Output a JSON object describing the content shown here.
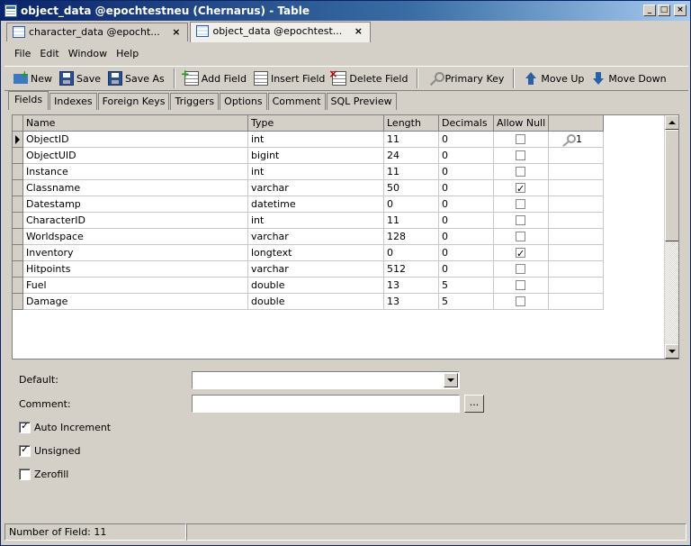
{
  "window": {
    "title": "object_data @epochtestneu (Chernarus) - Table",
    "minimize": "_",
    "maximize": "□",
    "close": "×"
  },
  "doc_tabs": [
    {
      "label": "character_data @epocht...",
      "close": "×",
      "active": false
    },
    {
      "label": "object_data @epochtest...",
      "close": "×",
      "active": true
    }
  ],
  "menu": [
    "File",
    "Edit",
    "Window",
    "Help"
  ],
  "toolbar": {
    "new_label": "New",
    "save_label": "Save",
    "save_as_label": "Save As",
    "add_field_label": "Add Field",
    "insert_field_label": "Insert Field",
    "delete_field_label": "Delete Field",
    "primary_key_label": "Primary Key",
    "move_up_label": "Move Up",
    "move_down_label": "Move Down"
  },
  "sub_tabs": [
    "Fields",
    "Indexes",
    "Foreign Keys",
    "Triggers",
    "Options",
    "Comment",
    "SQL Preview"
  ],
  "grid": {
    "columns": [
      "Name",
      "Type",
      "Length",
      "Decimals",
      "Allow Null",
      ""
    ],
    "rows": [
      {
        "name": "ObjectID",
        "type": "int",
        "length": "11",
        "decimals": "0",
        "allow_null": false,
        "key": "1"
      },
      {
        "name": "ObjectUID",
        "type": "bigint",
        "length": "24",
        "decimals": "0",
        "allow_null": false,
        "key": ""
      },
      {
        "name": "Instance",
        "type": "int",
        "length": "11",
        "decimals": "0",
        "allow_null": false,
        "key": ""
      },
      {
        "name": "Classname",
        "type": "varchar",
        "length": "50",
        "decimals": "0",
        "allow_null": true,
        "key": ""
      },
      {
        "name": "Datestamp",
        "type": "datetime",
        "length": "0",
        "decimals": "0",
        "allow_null": false,
        "key": ""
      },
      {
        "name": "CharacterID",
        "type": "int",
        "length": "11",
        "decimals": "0",
        "allow_null": false,
        "key": ""
      },
      {
        "name": "Worldspace",
        "type": "varchar",
        "length": "128",
        "decimals": "0",
        "allow_null": false,
        "key": ""
      },
      {
        "name": "Inventory",
        "type": "longtext",
        "length": "0",
        "decimals": "0",
        "allow_null": true,
        "key": ""
      },
      {
        "name": "Hitpoints",
        "type": "varchar",
        "length": "512",
        "decimals": "0",
        "allow_null": false,
        "key": ""
      },
      {
        "name": "Fuel",
        "type": "double",
        "length": "13",
        "decimals": "5",
        "allow_null": false,
        "key": ""
      },
      {
        "name": "Damage",
        "type": "double",
        "length": "13",
        "decimals": "5",
        "allow_null": false,
        "key": ""
      }
    ]
  },
  "props": {
    "default_label": "Default:",
    "default_value": "",
    "comment_label": "Comment:",
    "comment_value": "",
    "comment_button": "...",
    "auto_increment_label": "Auto Increment",
    "auto_increment": true,
    "unsigned_label": "Unsigned",
    "unsigned": true,
    "zerofill_label": "Zerofill",
    "zerofill": false
  },
  "status": {
    "field_count": "Number of Field: 11",
    "right": ""
  }
}
